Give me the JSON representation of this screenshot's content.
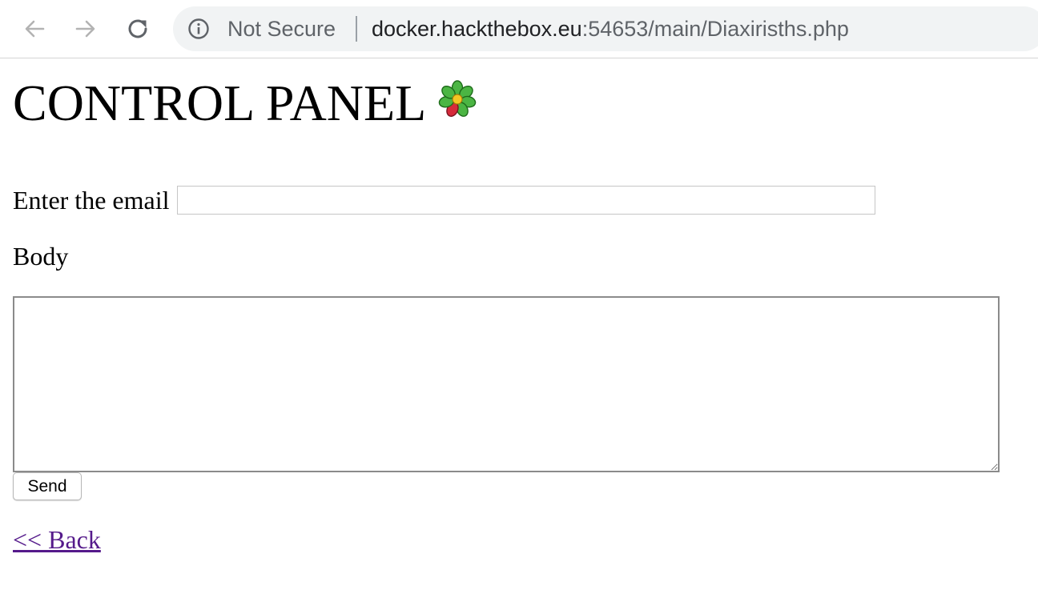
{
  "browser": {
    "security_label": "Not Secure",
    "url_host": "docker.hackthebox.eu",
    "url_rest": ":54653/main/Diaxirisths.php",
    "icons": {
      "back": "arrow-left-icon",
      "forward": "arrow-right-icon",
      "reload": "reload-icon",
      "security": "info-icon"
    }
  },
  "page": {
    "title": "CONTROL PANEL",
    "title_icon": "flower-icon",
    "email_label": "Enter the email",
    "email_value": "",
    "body_label": "Body",
    "body_value": "",
    "send_label": "Send",
    "back_link": "<< Back"
  },
  "colors": {
    "visited_link": "#551a8b",
    "omnibox_bg": "#f1f3f4",
    "url_secondary": "#5f6368"
  }
}
